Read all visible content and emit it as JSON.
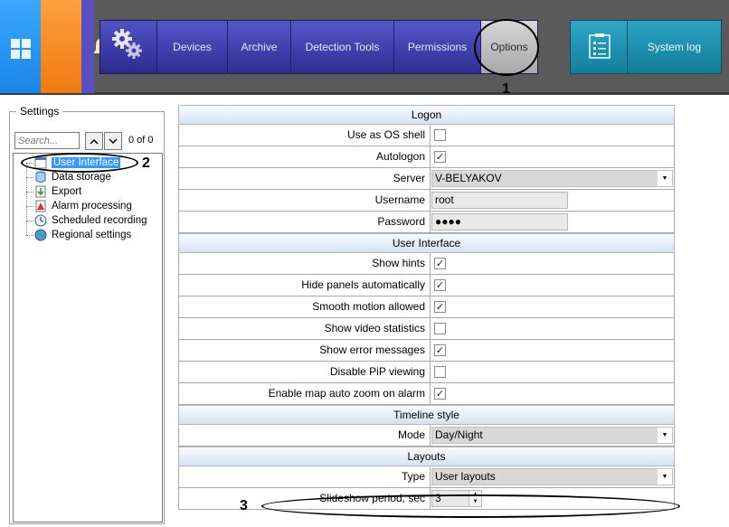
{
  "nav": {
    "tabs": [
      {
        "label": "Devices"
      },
      {
        "label": "Archive"
      },
      {
        "label": "Detection Tools"
      },
      {
        "label": "Permissions"
      },
      {
        "label": "Options",
        "active": true
      }
    ],
    "system_log_label": "System log"
  },
  "annotations": {
    "n1": "1",
    "n2": "2",
    "n3": "3"
  },
  "settings": {
    "title": "Settings",
    "search_placeholder": "Search...",
    "count": "0 of 0",
    "tree": [
      {
        "label": "User Interface",
        "selected": true,
        "icon": "window-icon"
      },
      {
        "label": "Data storage",
        "icon": "database-icon"
      },
      {
        "label": "Export",
        "icon": "export-icon"
      },
      {
        "label": "Alarm processing",
        "icon": "alarm-icon"
      },
      {
        "label": "Scheduled recording",
        "icon": "clock-icon"
      },
      {
        "label": "Regional settings",
        "icon": "globe-icon"
      }
    ]
  },
  "form": {
    "logon": {
      "header": "Logon",
      "use_os_shell": {
        "label": "Use as OS shell",
        "checked": false
      },
      "autologon": {
        "label": "Autologon",
        "checked": true
      },
      "server": {
        "label": "Server",
        "value": "V-BELYAKOV"
      },
      "username": {
        "label": "Username",
        "value": "root"
      },
      "password": {
        "label": "Password",
        "value": "●●●●"
      }
    },
    "ui": {
      "header": "User Interface",
      "show_hints": {
        "label": "Show hints",
        "checked": true
      },
      "hide_panels": {
        "label": "Hide panels automatically",
        "checked": true
      },
      "smooth_motion": {
        "label": "Smooth motion allowed",
        "checked": true
      },
      "show_video_stats": {
        "label": "Show video statistics",
        "checked": false
      },
      "show_errors": {
        "label": "Show error messages",
        "checked": true
      },
      "disable_pip": {
        "label": "Disable PiP viewing",
        "checked": false
      },
      "map_auto_zoom": {
        "label": "Enable map auto zoom on alarm",
        "checked": true
      }
    },
    "timeline": {
      "header": "Timeline style",
      "mode": {
        "label": "Mode",
        "value": "Day/Night"
      }
    },
    "layouts": {
      "header": "Layouts",
      "type": {
        "label": "Type",
        "value": "User layouts"
      },
      "slideshow": {
        "label": "Slideshow period, sec",
        "value": "3"
      }
    }
  },
  "check_mark": "✓",
  "colors": {
    "nav_blue": "#3a3aa8",
    "log_teal": "#1a90b0",
    "accent_blue": "#3399ff",
    "windows_tile": "#2196f3",
    "bell_tile": "#ff8c1a"
  }
}
